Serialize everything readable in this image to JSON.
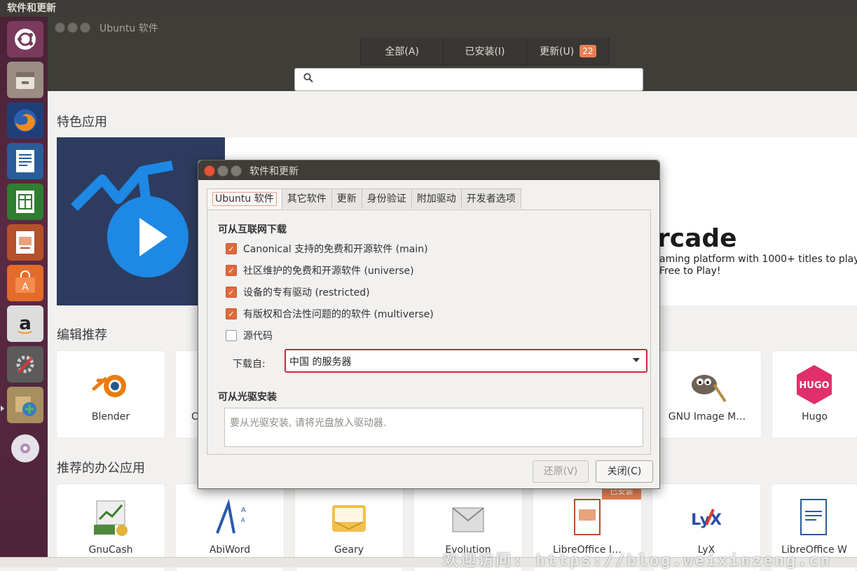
{
  "system": {
    "panel_title": "软件和更新"
  },
  "launcher": {
    "items": [
      {
        "name": "ubuntu-dash-icon"
      },
      {
        "name": "files-icon"
      },
      {
        "name": "firefox-icon"
      },
      {
        "name": "writer-icon"
      },
      {
        "name": "calc-icon"
      },
      {
        "name": "impress-icon"
      },
      {
        "name": "software-center-icon"
      },
      {
        "name": "amazon-icon"
      },
      {
        "name": "system-settings-icon"
      },
      {
        "name": "software-updater-icon"
      },
      {
        "name": "dvd-icon"
      }
    ]
  },
  "main": {
    "title": "Ubuntu 软件",
    "tabs": [
      {
        "label": "全部(A)"
      },
      {
        "label": "已安装(I)"
      },
      {
        "label": "更新(U)",
        "badge": "22"
      }
    ],
    "search_placeholder": "",
    "featured_title": "特色应用",
    "banner": {
      "heading": "rcade",
      "desc_line1": "aming platform with 1000+ titles to play",
      "desc_line2": "Free to Play!"
    },
    "editors_title": "编辑推荐",
    "editors_apps": [
      {
        "label": "Blender"
      },
      {
        "label": "C"
      },
      {
        "label": "GNU Image M…"
      },
      {
        "label": "Hugo"
      }
    ],
    "office_title": "推荐的办公应用",
    "office_apps": [
      {
        "label": "GnuCash"
      },
      {
        "label": "AbiWord"
      },
      {
        "label": "Geary"
      },
      {
        "label": "Evolution"
      },
      {
        "label": "LibreOffice I…",
        "ribbon": "已安装"
      },
      {
        "label": "LyX"
      },
      {
        "label": "LibreOffice W"
      }
    ]
  },
  "dialog": {
    "title": "软件和更新",
    "tabs": [
      "Ubuntu 软件",
      "其它软件",
      "更新",
      "身份验证",
      "附加驱动",
      "开发者选项"
    ],
    "internet_group": "可从互联网下载",
    "options": [
      {
        "label": "Canonical 支持的免费和开源软件 (main)",
        "checked": true
      },
      {
        "label": "社区维护的免费和开源软件 (universe)",
        "checked": true
      },
      {
        "label": "设备的专有驱动 (restricted)",
        "checked": true
      },
      {
        "label": "有版权和合法性问题的的软件 (multiverse)",
        "checked": true
      },
      {
        "label": "源代码",
        "checked": false
      }
    ],
    "download_from_label": "下载自:",
    "download_from_value": "中国 的服务器",
    "cdrom_group": "可从光驱安装",
    "cdrom_text": "要从光驱安装, 请将光盘放入驱动器.",
    "revert_label": "还原(V)",
    "close_label": "关闭(C)"
  },
  "watermark": "欢迎访问: https://blog.weixinzeng.cn",
  "colors": {
    "accent": "#e0693a",
    "badge": "#e77f52",
    "select_border": "#d3283a",
    "launcher": "#5a2a44"
  }
}
